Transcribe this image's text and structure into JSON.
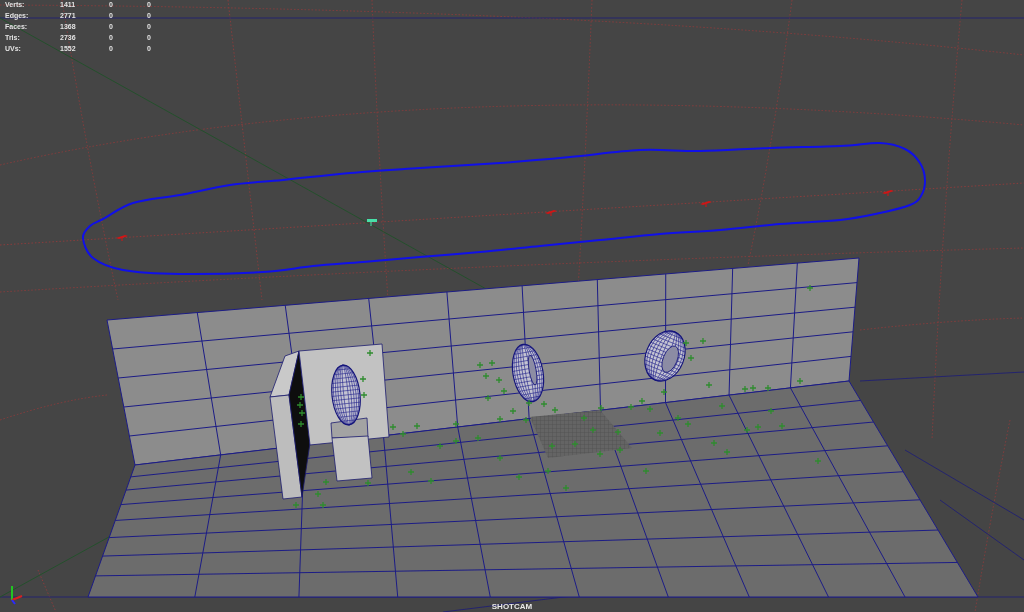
{
  "hud": {
    "rows": [
      {
        "label": "Verts:",
        "values": [
          "1411",
          "0",
          "0"
        ]
      },
      {
        "label": "Edges:",
        "values": [
          "2771",
          "0",
          "0"
        ]
      },
      {
        "label": "Faces:",
        "values": [
          "1368",
          "0",
          "0"
        ]
      },
      {
        "label": "Tris:",
        "values": [
          "2736",
          "0",
          "0"
        ]
      },
      {
        "label": "UVs:",
        "values": [
          "1552",
          "0",
          "0"
        ]
      }
    ]
  },
  "viewport": {
    "camera": "SHOTCAM"
  }
}
